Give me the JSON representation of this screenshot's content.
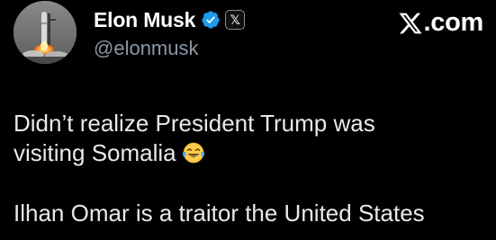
{
  "author": {
    "display_name": "Elon Musk",
    "handle": "@elonmusk",
    "verified_color": "#1d9bf0",
    "avatar_icon": "starship-launch-avatar",
    "affiliation_badge": "𝕏"
  },
  "site": {
    "logo_icon": "x-logo-icon",
    "label": ".com"
  },
  "tweet": {
    "line_1": "Didn’t realize President Trump was",
    "line_2": "visiting Somalia",
    "emoji": "face-with-tears-of-joy",
    "line_3": "Ilhan Omar is a traitor the United States"
  },
  "colors": {
    "background": "#000000",
    "text": "#e7e9ea",
    "muted": "#8b98a5",
    "accent": "#1d9bf0"
  }
}
